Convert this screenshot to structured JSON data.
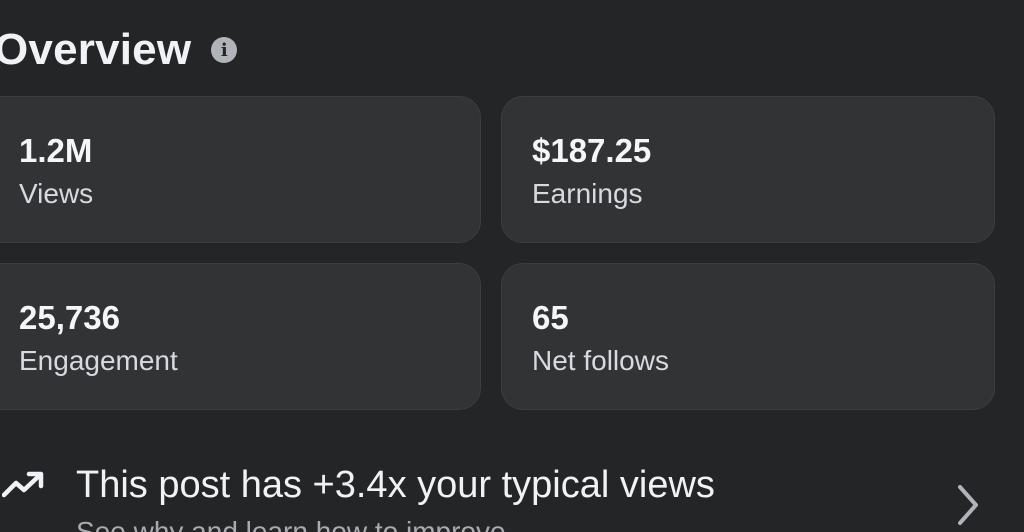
{
  "overview": {
    "title": "Overview",
    "info_icon": "info-icon"
  },
  "metrics": [
    {
      "value": "1.2M",
      "label": "Views"
    },
    {
      "value": "$187.25",
      "label": "Earnings"
    },
    {
      "value": "25,736",
      "label": "Engagement"
    },
    {
      "value": "65",
      "label": "Net follows"
    }
  ],
  "insight": {
    "icon": "trending-up-icon",
    "title": "This post has +3.4x your typical views",
    "subtitle": "See why and learn how to improve",
    "chevron": "chevron-right-icon"
  },
  "colors": {
    "background": "#242526",
    "card": "#323335",
    "text": "#f0f2f5",
    "muted": "#a8abb0"
  }
}
